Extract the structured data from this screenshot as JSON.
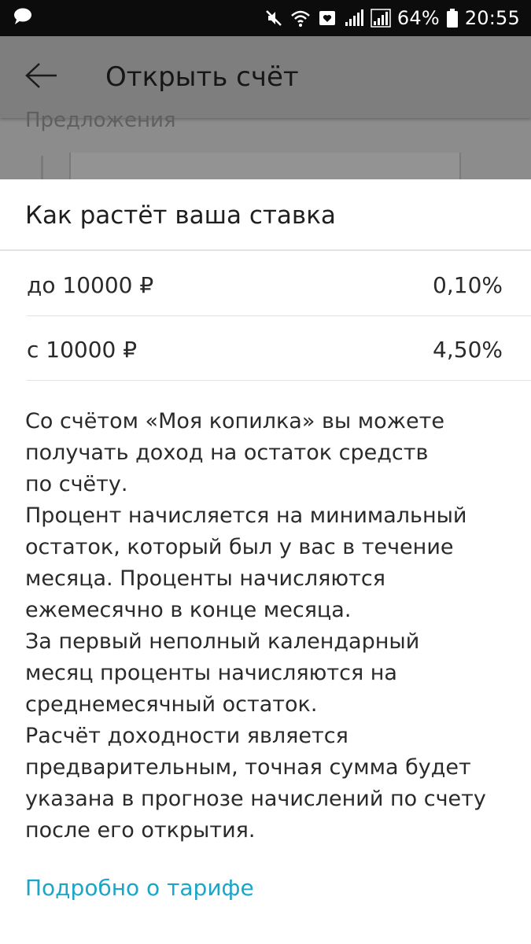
{
  "status_bar": {
    "left_icon": "chat-bubble-icon",
    "icons": [
      "mute-icon",
      "wifi-icon",
      "notification-icon",
      "signal-icon",
      "signal-icon",
      "battery-icon"
    ],
    "battery": "64%",
    "time": "20:55"
  },
  "background": {
    "title": "Открыть счёт",
    "back_icon": "back-arrow-icon",
    "offers_label": "Предложения"
  },
  "sheet": {
    "title": "Как растёт ваша ставка",
    "rates": [
      {
        "range": "до 10000 ₽",
        "rate": "0,10%"
      },
      {
        "range": "с 10000 ₽",
        "rate": "4,50%"
      }
    ],
    "description": "Со счётом «Моя копилка» вы можете\nполучать доход на остаток средств\nпо счёту.\n Процент начисляется на минимальный\nостаток, который был у вас в течение\nмесяца. Проценты начисляются\nежемесячно в конце месяца.\n За первый неполный календарный\nмесяц проценты начисляются на\nсреднемесячный остаток.\n Расчёт доходности является\nпредварительным, точная сумма будет\nуказана в прогнозе начислений по счету\nпосле его открытия.",
    "link": "Подробно о тарифе"
  },
  "colors": {
    "link": "#1aa6c8",
    "status_bar": "#0c0c0c",
    "scrim": "#8c8c8c"
  }
}
